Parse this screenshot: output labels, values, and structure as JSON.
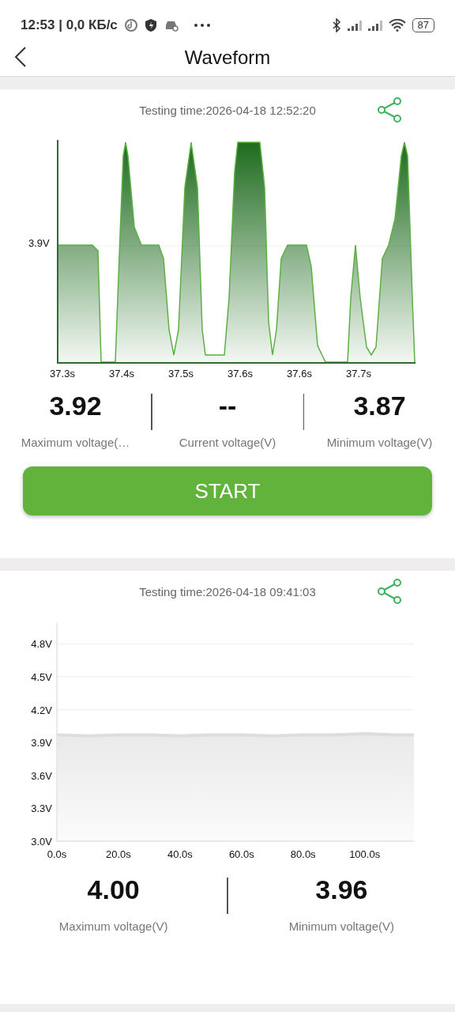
{
  "status_bar": {
    "time_and_speed": "12:53 | 0,0 КБ/с",
    "battery": "87"
  },
  "header": {
    "title": "Waveform"
  },
  "sessions": [
    {
      "testing_time": "Testing time:2026-04-18 12:52:20",
      "waveform": {
        "y_label": "3.9V",
        "x_labels": [
          "37.3s",
          "37.4s",
          "37.5s",
          "37.6s",
          "37.6s",
          "37.7s"
        ]
      },
      "stats": [
        {
          "value": "3.92",
          "label": "Maximum voltage(…"
        },
        {
          "value": "--",
          "label": "Current voltage(V)"
        },
        {
          "value": "3.87",
          "label": "Minimum voltage(V)"
        }
      ],
      "button": "START"
    },
    {
      "testing_time": "Testing time:2026-04-18 09:41:03",
      "chart_data": {
        "type": "area",
        "grid": true,
        "x": [
          0,
          10,
          20,
          30,
          40,
          50,
          60,
          70,
          80,
          90,
          100,
          110,
          116
        ],
        "ylim": [
          3.0,
          4.99
        ],
        "xlim": [
          0,
          116
        ],
        "yticks": [
          {
            "value": 3.0,
            "label": "3.0V"
          },
          {
            "value": 3.3,
            "label": "3.3V"
          },
          {
            "value": 3.6,
            "label": "3.6V"
          },
          {
            "value": 3.9,
            "label": "3.9V"
          },
          {
            "value": 4.2,
            "label": "4.2V"
          },
          {
            "value": 4.5,
            "label": "4.5V"
          },
          {
            "value": 4.8,
            "label": "4.8V"
          }
        ],
        "xticks": [
          {
            "value": 0,
            "label": "0.0s"
          },
          {
            "value": 20,
            "label": "20.0s"
          },
          {
            "value": 40,
            "label": "40.0s"
          },
          {
            "value": 60,
            "label": "60.0s"
          },
          {
            "value": 80,
            "label": "80.0s"
          },
          {
            "value": 100,
            "label": "100.0s"
          }
        ],
        "series": [
          {
            "color": "#dddddd",
            "values": [
              3.97,
              3.96,
              3.97,
              3.97,
              3.96,
              3.97,
              3.97,
              3.96,
              3.97,
              3.97,
              3.98,
              3.97,
              3.97
            ]
          }
        ]
      },
      "stats": [
        {
          "value": "4.00",
          "label": "Maximum voltage(V)"
        },
        {
          "value": "3.96",
          "label": "Minimum voltage(V)"
        }
      ]
    }
  ]
}
